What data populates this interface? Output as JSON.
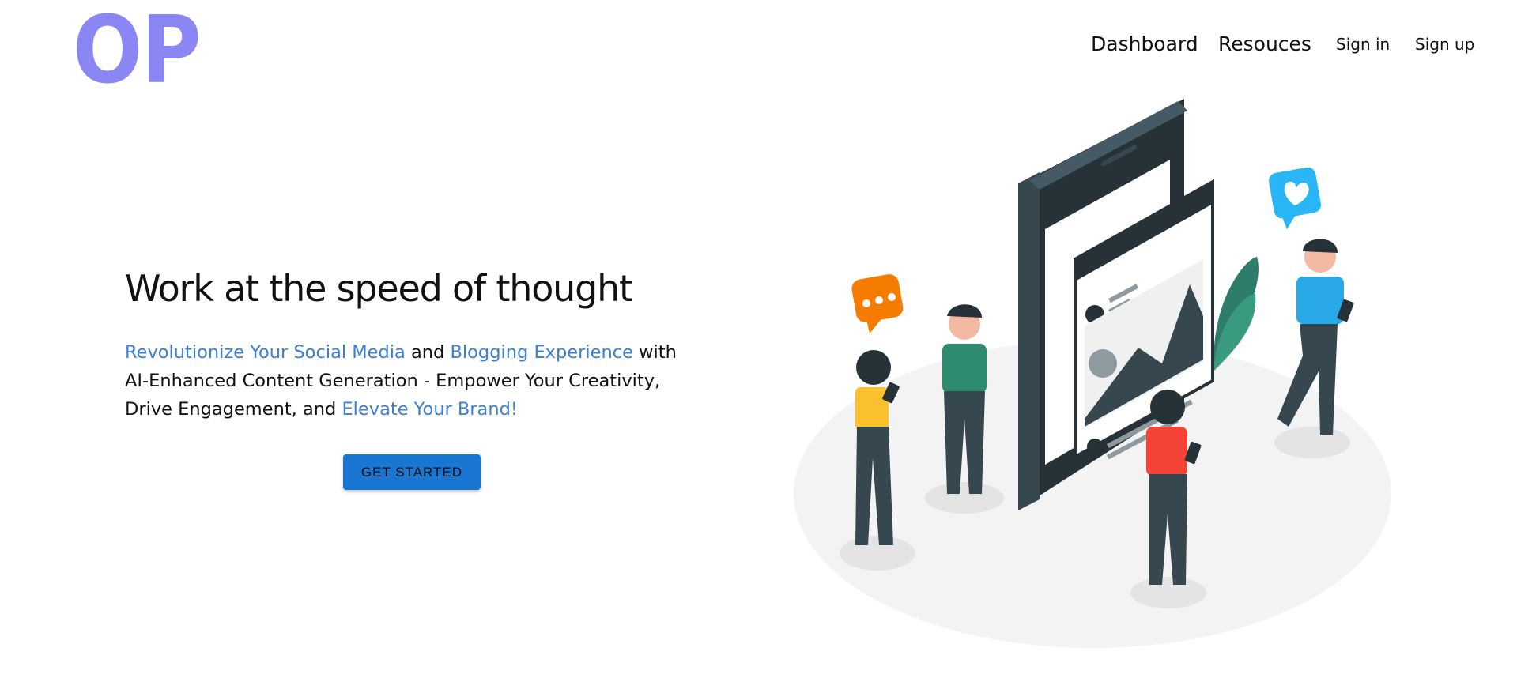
{
  "logo": {
    "text": "OP",
    "color": "#8a86f3"
  },
  "nav": {
    "items": [
      {
        "label": "Dashboard"
      },
      {
        "label": "Resouces"
      },
      {
        "label": "Sign in"
      },
      {
        "label": "Sign up"
      }
    ]
  },
  "hero": {
    "title": "Work at the speed of thought",
    "description": {
      "part1": "Revolutionize Your Social Media",
      "part2": " and ",
      "part3": "Blogging Experience",
      "part4": " with AI-Enhanced Content Generation - Empower Your Creativity, Drive Engagement, and ",
      "part5": "Elevate Your Brand!"
    },
    "cta_label": "GET STARTED"
  },
  "colors": {
    "accent": "#1976d2",
    "highlight_text": "#3b7fd8"
  },
  "illustration": {
    "icons": [
      "smartphone-icon",
      "chat-bubble-icon",
      "heart-icon",
      "image-post-icon",
      "leaf-icon"
    ]
  }
}
